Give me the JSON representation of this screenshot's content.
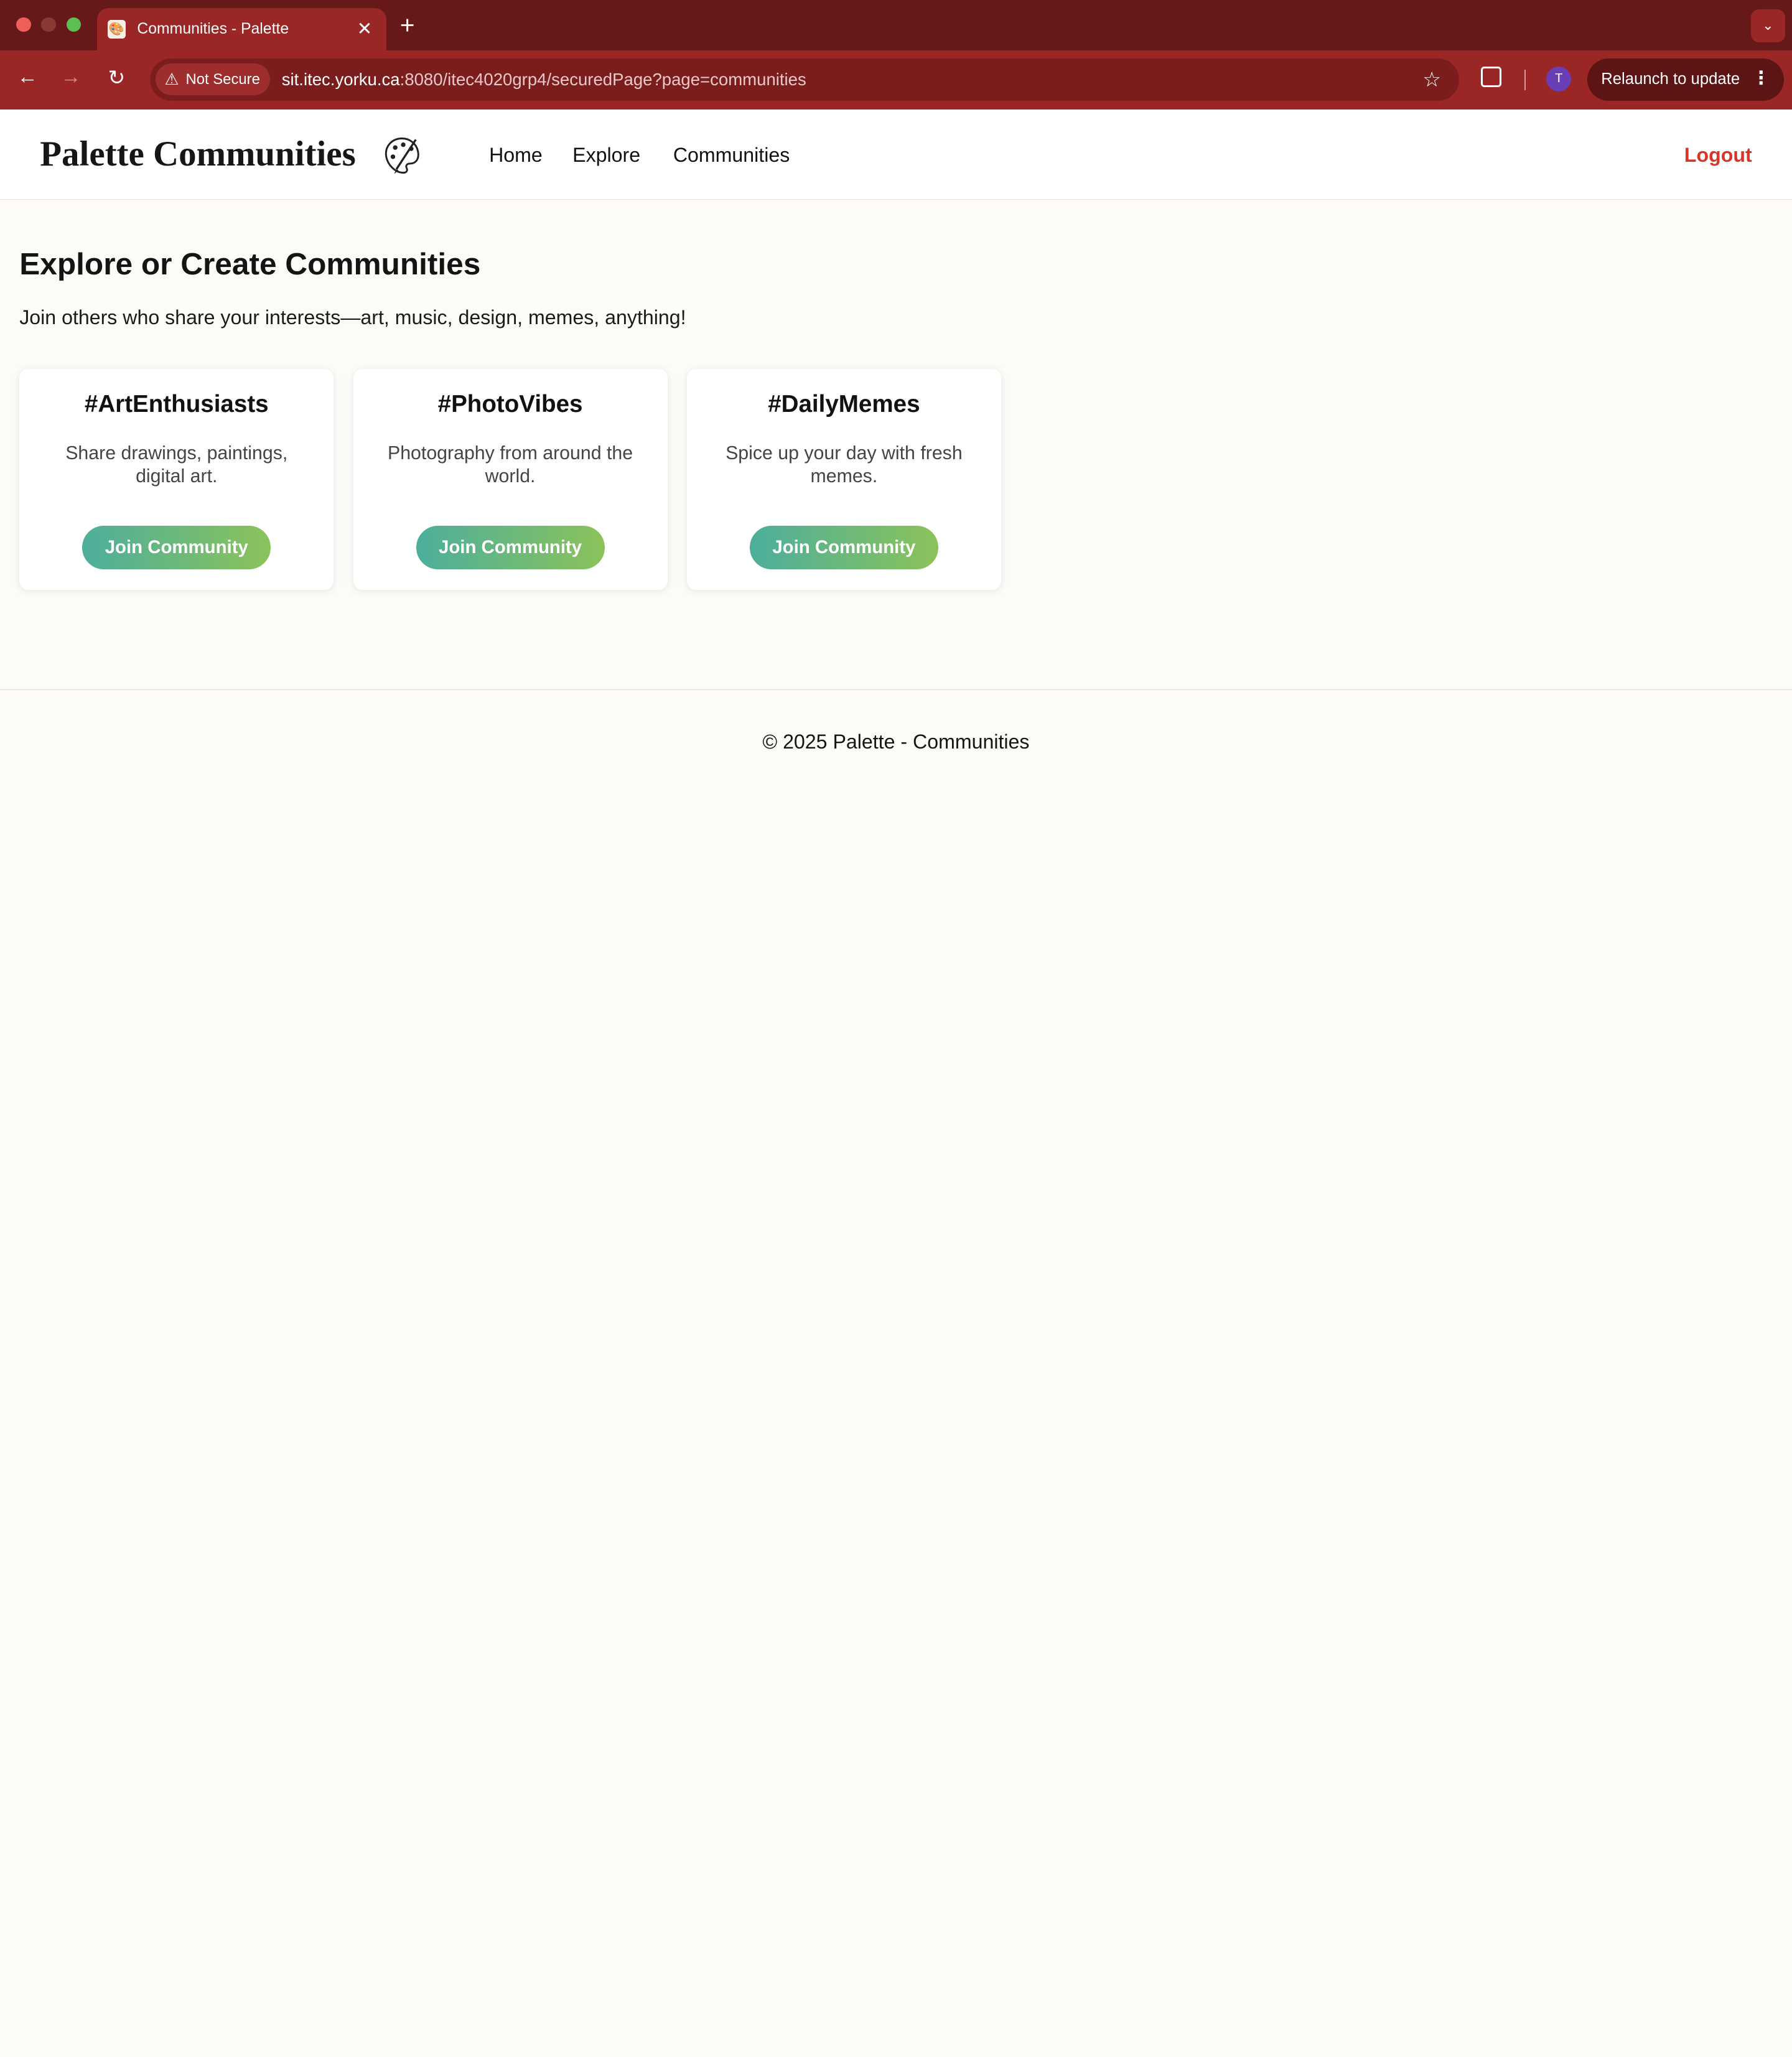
{
  "browser": {
    "tab_title": "Communities - Palette",
    "tab_favicon": "palette-favicon",
    "new_tab_symbol": "+",
    "close_symbol": "✕",
    "security_label": "Not Secure",
    "url_host": "sit.itec.yorku.ca",
    "url_rest": ":8080/itec4020grp4/securedPage?page=communities",
    "profile_initial": "T",
    "relaunch_label": "Relaunch to update",
    "colors": {
      "tabbar": "#671919",
      "toolbar": "#9a2626",
      "omnibox": "#7c1d1d",
      "profile": "#6a3fb5"
    }
  },
  "header": {
    "brand": "Palette Communities",
    "brand_icon": "artist-palette-icon",
    "nav": [
      "Home",
      "Explore",
      "Communities"
    ],
    "logout": "Logout",
    "logout_color": "#d9352b"
  },
  "main": {
    "title": "Explore or Create Communities",
    "subtitle": "Join others who share your interests—art, music, design, memes, anything!",
    "communities": [
      {
        "name": "#ArtEnthusiasts",
        "description": "Share drawings, paintings, digital art.",
        "button": "Join Community"
      },
      {
        "name": "#PhotoVibes",
        "description": "Photography from around the world.",
        "button": "Join Community"
      },
      {
        "name": "#DailyMemes",
        "description": "Spice up your day with fresh memes.",
        "button": "Join Community"
      }
    ],
    "button_gradient": [
      "#4cae9c",
      "#8bc35a"
    ]
  },
  "footer": {
    "text": "© 2025 Palette - Communities"
  }
}
